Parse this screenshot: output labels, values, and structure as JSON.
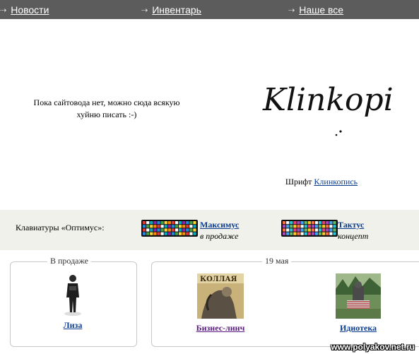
{
  "nav": {
    "items": [
      {
        "label": "Новости",
        "icon": "arrow-right-icon"
      },
      {
        "label": "Инвентарь",
        "icon": "arrow-right-icon"
      },
      {
        "label": "Наше все",
        "icon": "arrow-right-icon"
      }
    ]
  },
  "hero": {
    "placeholder_text": "Пока сайтовода нет, можно сюда всякую хуйню писать :-)",
    "logo_text": "Klinkopis",
    "font_credit_prefix": "Шрифт",
    "font_credit_link": "Клинкопись"
  },
  "keyboards": {
    "title": "Клавиатуры «Оптимус»:",
    "items": [
      {
        "name": "Максимус",
        "note": "в продаже"
      },
      {
        "name": "Тактус",
        "note": "концепт"
      }
    ]
  },
  "on_sale": {
    "legend": "В продаже",
    "items": [
      {
        "label": "Лиза"
      }
    ]
  },
  "dated": {
    "legend": "19 мая",
    "items": [
      {
        "label": "Бизнес-линч",
        "visited": true,
        "cover_text": "КОЛЛАЯ"
      },
      {
        "label": "Идиотека",
        "visited": false
      }
    ]
  },
  "watermark": "www.polyakov.net.ru",
  "colors": {
    "nav_bg": "#5c5c5c",
    "band_bg": "#f1f1eb",
    "link": "#0b3b8c",
    "visited_link": "#5a1a80"
  }
}
